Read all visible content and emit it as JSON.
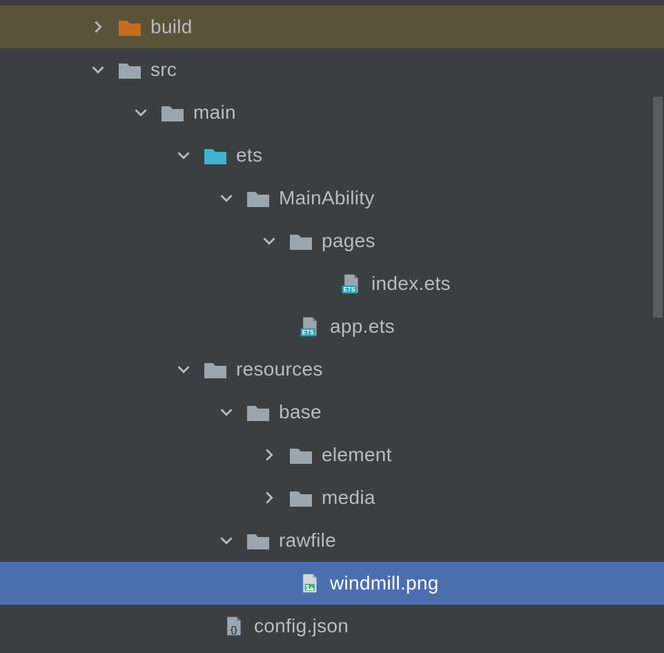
{
  "tree": {
    "build": {
      "label": "build",
      "expanded": false,
      "highlighted": true,
      "folderColor": "#c96b1f"
    },
    "src": {
      "label": "src",
      "expanded": true,
      "folderColor": "#9aa7b0"
    },
    "main": {
      "label": "main",
      "expanded": true,
      "folderColor": "#9aa7b0"
    },
    "ets": {
      "label": "ets",
      "expanded": true,
      "folderColor": "#3fb4d2"
    },
    "mainAbility": {
      "label": "MainAbility",
      "expanded": true,
      "folderColor": "#9aa7b0"
    },
    "pages": {
      "label": "pages",
      "expanded": true,
      "folderColor": "#9aa7b0"
    },
    "indexEts": {
      "label": "index.ets",
      "iconType": "ets"
    },
    "appEts": {
      "label": "app.ets",
      "iconType": "ets"
    },
    "resources": {
      "label": "resources",
      "expanded": true,
      "folderColor": "#9aa7b0"
    },
    "base": {
      "label": "base",
      "expanded": true,
      "folderColor": "#9aa7b0"
    },
    "element": {
      "label": "element",
      "expanded": false,
      "folderColor": "#9aa7b0"
    },
    "media": {
      "label": "media",
      "expanded": false,
      "folderColor": "#9aa7b0"
    },
    "rawfile": {
      "label": "rawfile",
      "expanded": true,
      "folderColor": "#9aa7b0"
    },
    "windmill": {
      "label": "windmill.png",
      "iconType": "image",
      "selected": true
    },
    "configJson": {
      "label": "config.json",
      "iconType": "json"
    }
  },
  "indents": {
    "d0": 128,
    "d1": 128,
    "d2": 190,
    "d3": 252,
    "d4": 314,
    "d5": 376,
    "d6_file": 490,
    "d5_file": 430,
    "d4_res": 252,
    "d5_res": 314,
    "d6_res": 376,
    "d6_res_file": 430,
    "d4_file": 320
  }
}
